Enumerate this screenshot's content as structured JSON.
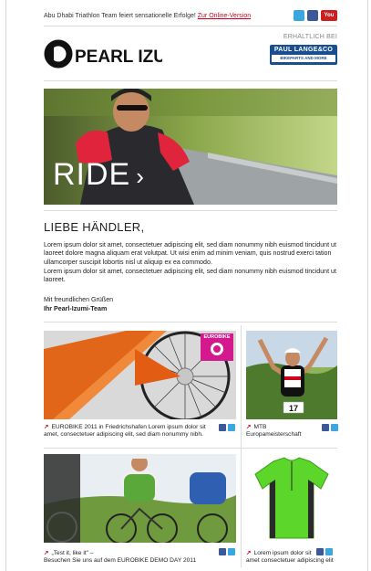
{
  "topbar": {
    "headline": "Abu Dhabi Triathlon Team feiert sensationelle Erfolge!",
    "online_link": "Zur Online-Version",
    "youtube_label": "You"
  },
  "brand": {
    "logo_text": "PEARL IZUMi",
    "available_at": "ERHÄLTLICH BEI",
    "dealer_name": "PAUL LANGE&CO",
    "dealer_tagline": "BIKEPARTS AND MORE"
  },
  "hero": {
    "label": "RIDE"
  },
  "greeting": "LIEBE HÄNDLER,",
  "paragraphs": [
    "Lorem ipsum dolor sit amet, consectetuer adipiscing elit, sed diam nonummy nibh euismod tincidunt ut laoreet dolore magna aliquam erat volutpat. Ut wisi enim ad minim veniam, quis nostrud exerci tation ullamcorper suscipit lobortis nisl ut aliquip ex ea commodo.",
    "Lorem ipsum dolor sit amet, consectetuer adipiscing elit, sed diam nonummy nibh euismod tincidunt ut laoreet."
  ],
  "signoff": {
    "line1": "Mit freundlichen Grüßen",
    "line2": "Ihr Pearl-Izumi-Team"
  },
  "tiles": [
    {
      "badge": "EUROBIKE",
      "line1": "EUROBIKE 2011 in Friedrichshafen Lorem ipsum dolor sit",
      "line2": "amet, consectetuer adipiscing elit, sed diam nonummy nibh."
    },
    {
      "line1": "MTB",
      "line2": "Europameisterschaft",
      "bib": "17"
    },
    {
      "line1": "„Test it, like it\" –",
      "line2": "Besuchen Sie uns auf dem EUROBIKE DEMO DAY 2011"
    },
    {
      "line1": "Lorem ipsum dolor sit",
      "line2": "amet consectetuer adipiscing elit"
    }
  ],
  "colors": {
    "accent": "#d0021b",
    "facebook": "#3b5998",
    "twitter": "#3aa7e0",
    "youtube": "#cc1f1f"
  }
}
